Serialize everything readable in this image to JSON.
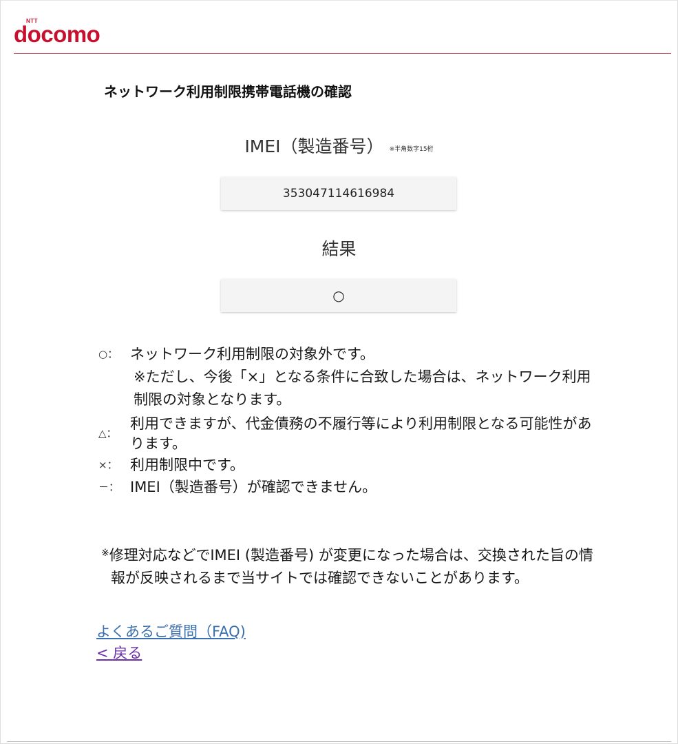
{
  "brand": {
    "logo_small": "NTT",
    "logo_text": "docomo",
    "color": "#c8102e"
  },
  "page": {
    "title": "ネットワーク利用制限携帯電話機の確認"
  },
  "imei": {
    "label": "IMEI（製造番号）",
    "note": "※半角数字15桁",
    "value": "353047114616984"
  },
  "result": {
    "label": "結果",
    "value": "○"
  },
  "legend": {
    "items": [
      {
        "symbol": "○：",
        "text": "ネットワーク利用制限の対象外です。",
        "sub": "※ただし、今後「×」となる条件に合致した場合は、ネットワーク利用制限の対象となります。"
      },
      {
        "symbol": "△：",
        "text": "利用できますが、代金債務の不履行等により利用制限となる可能性があります。"
      },
      {
        "symbol": "×：",
        "text": "利用制限中です。"
      },
      {
        "symbol": "－：",
        "text": "IMEI（製造番号）が確認できません。"
      }
    ]
  },
  "note": {
    "mark": "※",
    "text": "修理対応などでIMEI (製造番号) が変更になった場合は、交換された旨の情報が反映されるまで当サイトでは確認できないことがあります。"
  },
  "links": {
    "faq": "よくあるご質問（FAQ)",
    "back": "< 戻る"
  }
}
